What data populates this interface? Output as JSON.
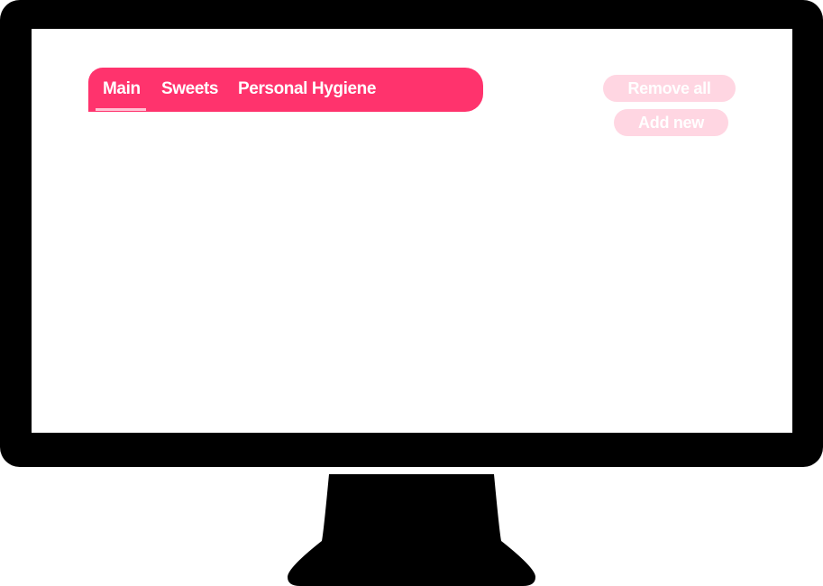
{
  "tabs": [
    {
      "label": "Main"
    },
    {
      "label": "Sweets"
    },
    {
      "label": "Personal Hygiene"
    }
  ],
  "actions": {
    "remove_all_label": "Remove all",
    "add_new_label": "Add new"
  },
  "colors": {
    "accent": "#ff336d",
    "button_bg": "#ffd6e2",
    "tab_text": "#ffffff",
    "bezel": "#000000"
  }
}
